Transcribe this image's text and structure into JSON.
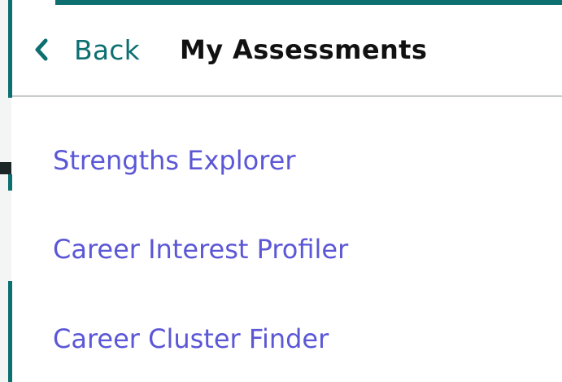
{
  "header": {
    "back_label": "Back",
    "title": "My Assessments",
    "back_icon": "chevron-left-icon"
  },
  "menu": {
    "items": [
      {
        "label": "Strengths Explorer"
      },
      {
        "label": "Career Interest Profiler"
      },
      {
        "label": "Career Cluster Finder"
      }
    ]
  },
  "colors": {
    "accent": "#0e6f71",
    "link": "#5b57d6",
    "title": "#111111",
    "divider": "#c9cccc"
  }
}
